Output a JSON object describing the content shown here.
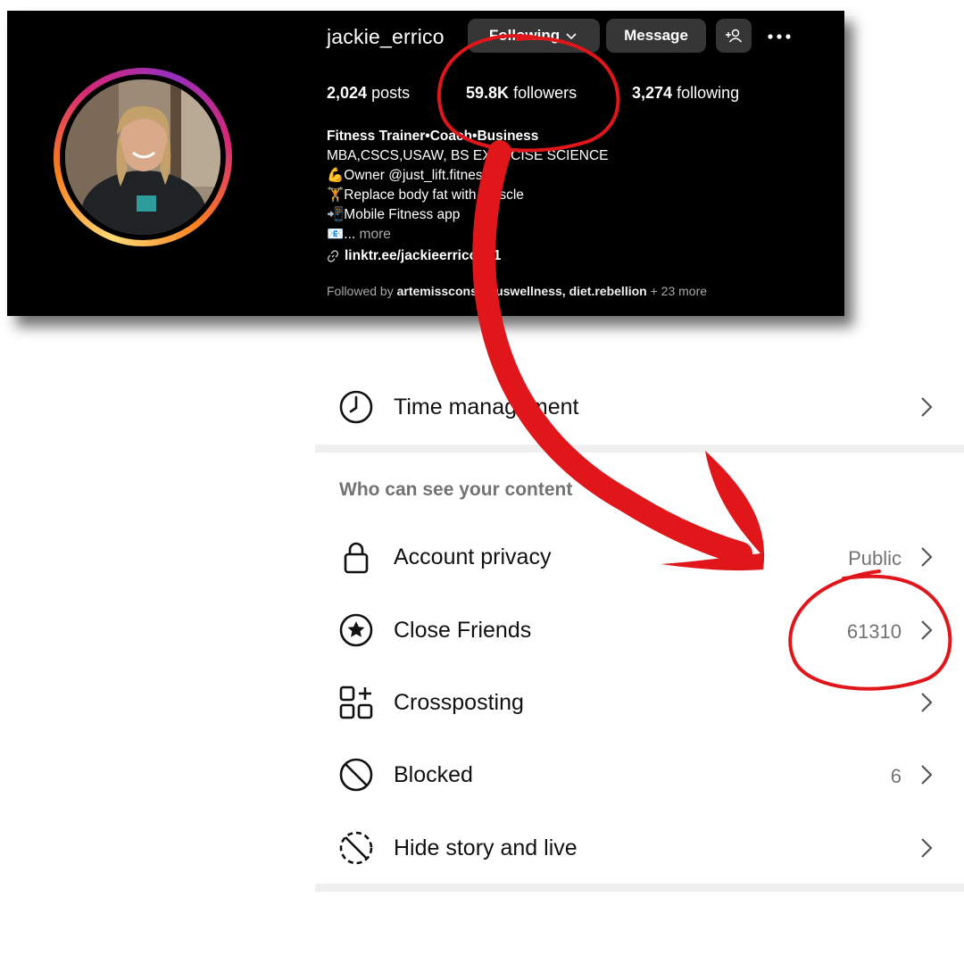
{
  "profile": {
    "username": "jackie_errico",
    "buttons": {
      "following": "Following",
      "message": "Message"
    },
    "stats": {
      "posts_value": "2,024",
      "posts_label": "posts",
      "followers_value": "59.8K",
      "followers_label": "followers",
      "following_value": "3,274",
      "following_label": "following"
    },
    "bio": {
      "name_line": "Fitness Trainer•Coach•Business",
      "credentials": "MBA,CSCS,USAW, BS EXERCISE SCIENCE",
      "line_owner": "💪Owner @just_lift.fitness",
      "line_replace": "🏋️Replace body fat with muscle",
      "line_app": "📲Mobile Fitness app",
      "line_more_prefix": "📧...",
      "more_label": "more",
      "link": "linktr.ee/jackieerrico + 1"
    },
    "followed_by": {
      "prefix": "Followed by",
      "names": "artemissconsciouswellness, diet.rebellion",
      "suffix": "+ 23 more"
    }
  },
  "settings": {
    "time_management": {
      "label": "Time management",
      "icon": "clock-icon"
    },
    "section_header": "Who can see your content",
    "account_privacy": {
      "label": "Account privacy",
      "value": "Public",
      "icon": "lock-icon"
    },
    "close_friends": {
      "label": "Close Friends",
      "value": "61310",
      "icon": "star-circle-icon"
    },
    "crossposting": {
      "label": "Crossposting",
      "icon": "grid-plus-icon"
    },
    "blocked": {
      "label": "Blocked",
      "value": "6",
      "icon": "blocked-icon"
    },
    "hide_story": {
      "label": "Hide story and live",
      "icon": "hide-story-icon"
    }
  },
  "annotation": {
    "color": "#e0161b"
  },
  "colors": {
    "panel_bg": "#000000",
    "button_bg": "#363636",
    "muted_text": "#737373"
  }
}
